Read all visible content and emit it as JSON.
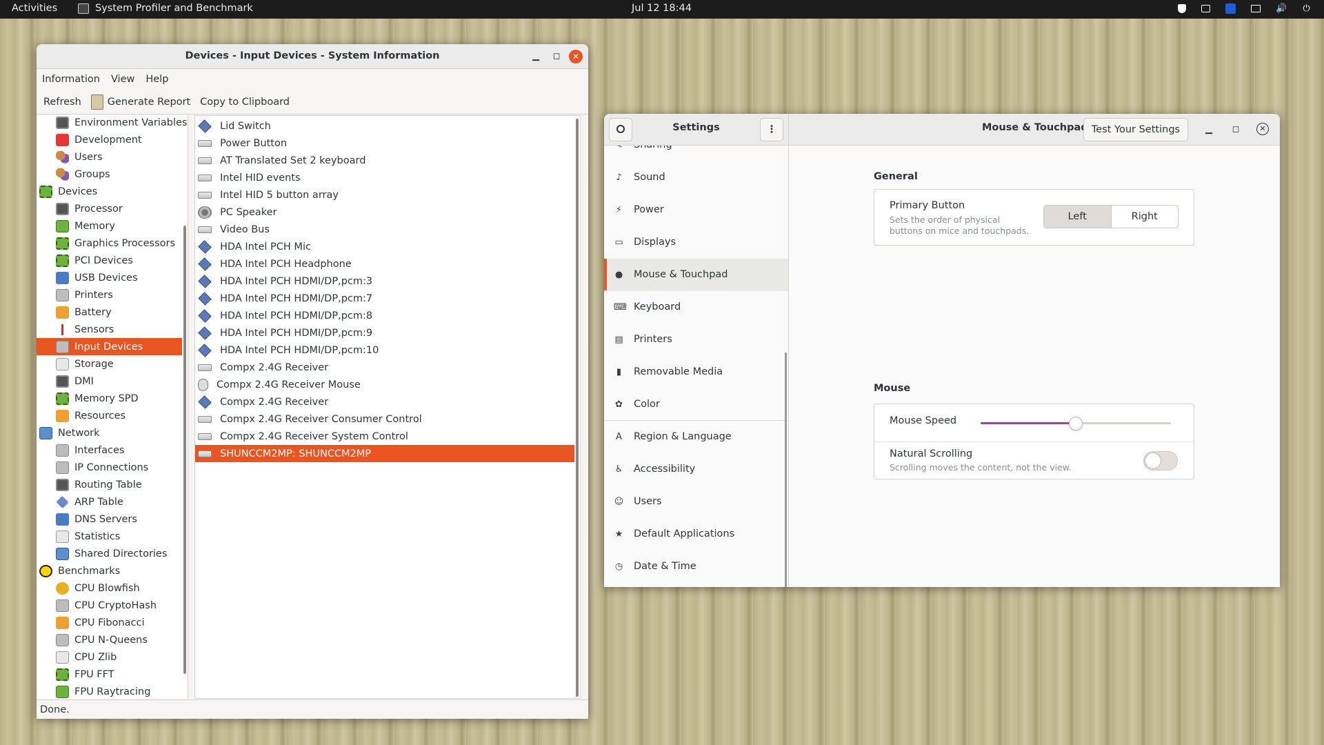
{
  "topbar": {
    "activities": "Activities",
    "app_name": "System Profiler and Benchmark",
    "clock": "Jul 12  18:44"
  },
  "profiler": {
    "title": "Devices - Input Devices - System Information",
    "menu": [
      "Information",
      "View",
      "Help"
    ],
    "toolbar": {
      "refresh": "Refresh",
      "report": "Generate Report",
      "copy": "Copy to Clipboard"
    },
    "tree": [
      {
        "label": "Environment Variables",
        "icon": "monitor-icon",
        "kind": "child",
        "cls": "monitor"
      },
      {
        "label": "Development",
        "icon": "development-icon",
        "kind": "child",
        "cls": "red"
      },
      {
        "label": "Users",
        "icon": "users-icon",
        "kind": "child",
        "cls": "people"
      },
      {
        "label": "Groups",
        "icon": "groups-icon",
        "kind": "child",
        "cls": "people"
      },
      {
        "label": "Devices",
        "icon": "devices-icon",
        "kind": "top",
        "cls": "chip"
      },
      {
        "label": "Processor",
        "icon": "processor-icon",
        "kind": "child",
        "cls": "monitor"
      },
      {
        "label": "Memory",
        "icon": "memory-icon",
        "kind": "child",
        "cls": "green"
      },
      {
        "label": "Graphics Processors",
        "icon": "gpu-icon",
        "kind": "child",
        "cls": "chip"
      },
      {
        "label": "PCI Devices",
        "icon": "pci-icon",
        "kind": "child",
        "cls": "chip"
      },
      {
        "label": "USB Devices",
        "icon": "usb-icon",
        "kind": "child",
        "cls": "blue"
      },
      {
        "label": "Printers",
        "icon": "printer-icon",
        "kind": "child",
        "cls": "gray"
      },
      {
        "label": "Battery",
        "icon": "battery-icon",
        "kind": "child",
        "cls": "orange"
      },
      {
        "label": "Sensors",
        "icon": "thermometer-icon",
        "kind": "child",
        "cls": "therm"
      },
      {
        "label": "Input Devices",
        "icon": "keyboard-icon",
        "kind": "child",
        "cls": "gray",
        "selected": true
      },
      {
        "label": "Storage",
        "icon": "storage-icon",
        "kind": "child",
        "cls": "box"
      },
      {
        "label": "DMI",
        "icon": "dmi-icon",
        "kind": "child",
        "cls": "monitor"
      },
      {
        "label": "Memory SPD",
        "icon": "memory-spd-icon",
        "kind": "child",
        "cls": "chip"
      },
      {
        "label": "Resources",
        "icon": "resources-icon",
        "kind": "child",
        "cls": "orange"
      },
      {
        "label": "Network",
        "icon": "network-icon",
        "kind": "top",
        "cls": "net"
      },
      {
        "label": "Interfaces",
        "icon": "interfaces-icon",
        "kind": "child",
        "cls": "gray"
      },
      {
        "label": "IP Connections",
        "icon": "ip-connections-icon",
        "kind": "child",
        "cls": "gray"
      },
      {
        "label": "Routing Table",
        "icon": "routing-table-icon",
        "kind": "child",
        "cls": "monitor"
      },
      {
        "label": "ARP Table",
        "icon": "arp-table-icon",
        "kind": "child",
        "cls": "dia"
      },
      {
        "label": "DNS Servers",
        "icon": "dns-icon",
        "kind": "child",
        "cls": "blue"
      },
      {
        "label": "Statistics",
        "icon": "statistics-icon",
        "kind": "child",
        "cls": "box"
      },
      {
        "label": "Shared Directories",
        "icon": "shared-dirs-icon",
        "kind": "child",
        "cls": "net"
      },
      {
        "label": "Benchmarks",
        "icon": "benchmarks-icon",
        "kind": "top",
        "cls": "cross"
      },
      {
        "label": "CPU Blowfish",
        "icon": "blowfish-icon",
        "kind": "child",
        "cls": "gold"
      },
      {
        "label": "CPU CryptoHash",
        "icon": "cryptohash-icon",
        "kind": "child",
        "cls": "gray"
      },
      {
        "label": "CPU Fibonacci",
        "icon": "fibonacci-icon",
        "kind": "child",
        "cls": "orange"
      },
      {
        "label": "CPU N-Queens",
        "icon": "nqueens-icon",
        "kind": "child",
        "cls": "gray"
      },
      {
        "label": "CPU Zlib",
        "icon": "zlib-icon",
        "kind": "child",
        "cls": "box"
      },
      {
        "label": "FPU FFT",
        "icon": "fft-icon",
        "kind": "child",
        "cls": "chip"
      },
      {
        "label": "FPU Raytracing",
        "icon": "raytracing-icon",
        "kind": "child",
        "cls": "green"
      }
    ],
    "devices": [
      {
        "label": "Lid Switch",
        "icon": "diamond-icon",
        "cls": "ldia"
      },
      {
        "label": "Power Button",
        "icon": "keyboard-icon",
        "cls": "kbd"
      },
      {
        "label": "AT Translated Set 2 keyboard",
        "icon": "keyboard-icon",
        "cls": "kbd"
      },
      {
        "label": "Intel HID events",
        "icon": "keyboard-icon",
        "cls": "kbd"
      },
      {
        "label": "Intel HID 5 button array",
        "icon": "keyboard-icon",
        "cls": "kbd"
      },
      {
        "label": "PC Speaker",
        "icon": "speaker-icon",
        "cls": "spk"
      },
      {
        "label": "Video Bus",
        "icon": "keyboard-icon",
        "cls": "kbd"
      },
      {
        "label": "HDA Intel PCH Mic",
        "icon": "diamond-icon",
        "cls": "ldia"
      },
      {
        "label": "HDA Intel PCH Headphone",
        "icon": "diamond-icon",
        "cls": "ldia"
      },
      {
        "label": "HDA Intel PCH HDMI/DP,pcm:3",
        "icon": "diamond-icon",
        "cls": "ldia"
      },
      {
        "label": "HDA Intel PCH HDMI/DP,pcm:7",
        "icon": "diamond-icon",
        "cls": "ldia"
      },
      {
        "label": "HDA Intel PCH HDMI/DP,pcm:8",
        "icon": "diamond-icon",
        "cls": "ldia"
      },
      {
        "label": "HDA Intel PCH HDMI/DP,pcm:9",
        "icon": "diamond-icon",
        "cls": "ldia"
      },
      {
        "label": "HDA Intel PCH HDMI/DP,pcm:10",
        "icon": "diamond-icon",
        "cls": "ldia"
      },
      {
        "label": "Compx 2.4G Receiver",
        "icon": "keyboard-icon",
        "cls": "kbd"
      },
      {
        "label": "Compx 2.4G Receiver Mouse",
        "icon": "mouse-icon",
        "cls": "mouse"
      },
      {
        "label": "Compx 2.4G Receiver",
        "icon": "diamond-icon",
        "cls": "ldia"
      },
      {
        "label": "Compx 2.4G Receiver Consumer Control",
        "icon": "keyboard-icon",
        "cls": "kbd"
      },
      {
        "label": "Compx 2.4G Receiver System Control",
        "icon": "keyboard-icon",
        "cls": "kbd"
      },
      {
        "label": "SHUNCCM2MP: SHUNCCM2MP",
        "icon": "keyboard-icon",
        "cls": "kbd",
        "selected": true
      }
    ],
    "status": "Done."
  },
  "settings": {
    "title": "Settings",
    "panel_title": "Mouse & Touchpad",
    "test_button": "Test Your Settings",
    "sidebar": [
      {
        "label": "Sharing",
        "icon": "sharing-icon",
        "glyph": "<"
      },
      {
        "label": "Sound",
        "icon": "sound-icon",
        "glyph": "♪"
      },
      {
        "label": "Power",
        "icon": "power-icon",
        "glyph": "⚡"
      },
      {
        "label": "Displays",
        "icon": "displays-icon",
        "glyph": "▭"
      },
      {
        "label": "Mouse & Touchpad",
        "icon": "mouse-icon",
        "glyph": "●",
        "active": true
      },
      {
        "label": "Keyboard",
        "icon": "keyboard-icon",
        "glyph": "⌨"
      },
      {
        "label": "Printers",
        "icon": "printer-icon",
        "glyph": "▤"
      },
      {
        "label": "Removable Media",
        "icon": "removable-media-icon",
        "glyph": "▮"
      },
      {
        "label": "Color",
        "icon": "color-icon",
        "glyph": "✿",
        "sep_after": true
      },
      {
        "label": "Region & Language",
        "icon": "region-icon",
        "glyph": "A"
      },
      {
        "label": "Accessibility",
        "icon": "accessibility-icon",
        "glyph": "♿"
      },
      {
        "label": "Users",
        "icon": "users-icon",
        "glyph": "☺"
      },
      {
        "label": "Default Applications",
        "icon": "star-icon",
        "glyph": "★"
      },
      {
        "label": "Date & Time",
        "icon": "clock-icon",
        "glyph": "◷"
      }
    ],
    "general": {
      "title": "General",
      "primary_label": "Primary Button",
      "primary_sub": "Sets the order of physical buttons on mice and touchpads.",
      "left": "Left",
      "right": "Right",
      "selected": "Left"
    },
    "mouse": {
      "title": "Mouse",
      "speed_label": "Mouse Speed",
      "speed_value": 0.5,
      "natural_label": "Natural Scrolling",
      "natural_sub": "Scrolling moves the content, not the view.",
      "natural_on": false
    },
    "accent": "#e95420",
    "slider_color": "#924d8b"
  }
}
